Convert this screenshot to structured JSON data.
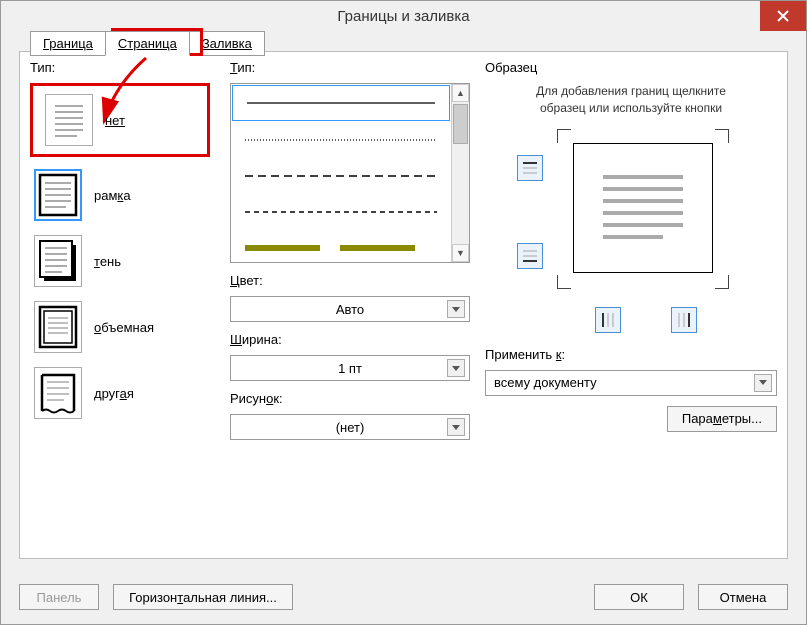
{
  "title": "Границы и заливка",
  "tabs": {
    "border": "Граница",
    "page": "Страница",
    "shading": "Заливка"
  },
  "left": {
    "label": "Тип:",
    "items": {
      "none": "нет",
      "box": "рамка",
      "shadow": "тень",
      "vol": "объемная",
      "custom": "другая"
    }
  },
  "mid": {
    "type_label": "Тип:",
    "color_label": "Цвет:",
    "color_value": "Авто",
    "width_label": "Ширина:",
    "width_value": "1 пт",
    "art_label": "Рисунок:",
    "art_value": "(нет)"
  },
  "right": {
    "label": "Образец",
    "hint1": "Для добавления границ щелкните",
    "hint2": "образец или используйте кнопки",
    "apply_label": "Применить к:",
    "apply_value": "всему документу",
    "options_btn": "Параметры..."
  },
  "footer": {
    "panel": "Панель",
    "hline": "Горизонтальная линия...",
    "ok": "ОК",
    "cancel": "Отмена"
  }
}
